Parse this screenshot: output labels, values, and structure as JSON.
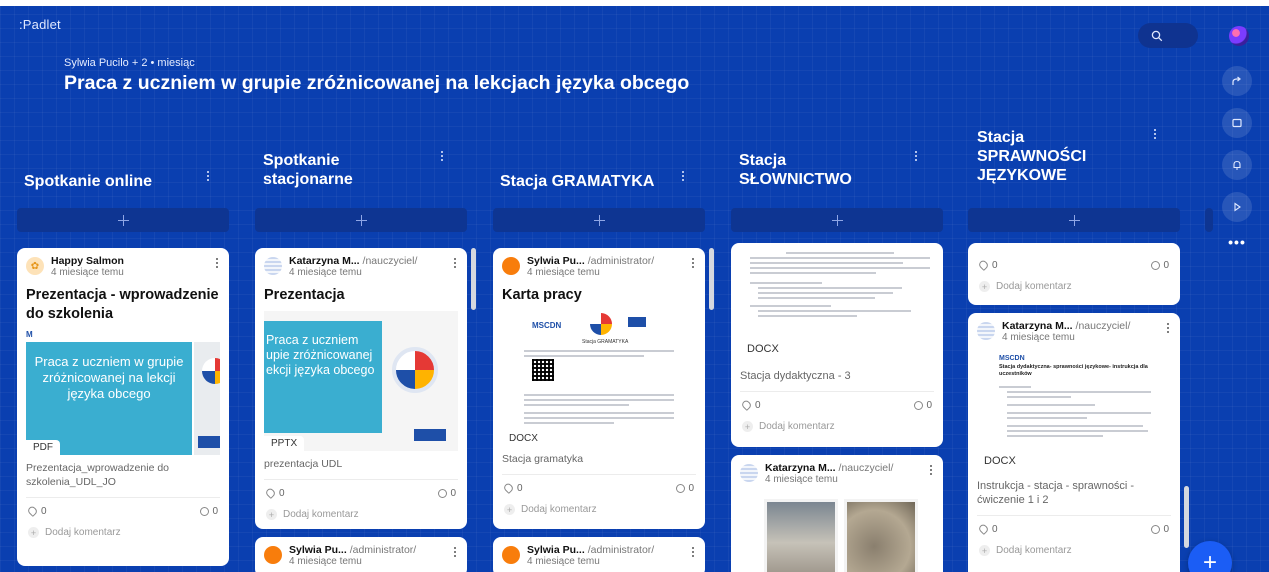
{
  "app": {
    "logo": ":Padlet"
  },
  "header": {
    "meta": "Sylwia Pucilo + 2 • miesiąc",
    "title": "Praca z uczniem w grupie zróżnicowanej na lekcjach języka obcego"
  },
  "icons": {
    "search": "search-icon",
    "share": "share-icon",
    "remake": "copy-icon",
    "notifications": "bell-icon",
    "slideshow": "play-icon",
    "more": "•••"
  },
  "columns": [
    {
      "title": "Spotkanie online"
    },
    {
      "title": "Spotkanie stacjonarne"
    },
    {
      "title": "Stacja GRAMATYKA"
    },
    {
      "title": "Stacja SŁOWNICTWO"
    },
    {
      "title": "Stacja SPRAWNOŚCI JĘZYKOWE"
    }
  ],
  "cards": {
    "c1": {
      "author": "Happy Salmon",
      "time": "4 miesiące temu",
      "title": "Prezentacja - wprowadzenie do szkolenia",
      "preview_text": "Praca z uczniem w grupie zróżnicowanej na lekcji języka obcego",
      "filetype": "PDF",
      "caption": "Prezentacja_wprowadzenie do szkolenia_UDL_JO",
      "likes": "0",
      "comments": "0",
      "add_comment": "Dodaj komentarz"
    },
    "c2": {
      "author": "Katarzyna M...",
      "role": "/nauczyciel/",
      "time": "4 miesiące temu",
      "title": "Prezentacja",
      "preview_text": "Praca z uczniem upie zróżnicowanej ekcji języka obcego",
      "filetype": "PPTX",
      "caption": "prezentacja UDL",
      "likes": "0",
      "comments": "0",
      "add_comment": "Dodaj komentarz"
    },
    "c2b": {
      "author": "Sylwia Pu...",
      "role": "/administrator/",
      "time": "4 miesiące temu"
    },
    "c3": {
      "author": "Sylwia Pu...",
      "role": "/administrator/",
      "time": "4 miesiące temu",
      "title": "Karta pracy",
      "preview_heading": "Stacja GRAMATYKA",
      "preview_brand": "MSCDN",
      "filetype": "DOCX",
      "caption": "Stacja gramatyka",
      "likes": "0",
      "comments": "0",
      "add_comment": "Dodaj komentarz"
    },
    "c3b": {
      "author": "Sylwia Pu...",
      "role": "/administrator/",
      "time": "4 miesiące temu"
    },
    "c4": {
      "filetype": "DOCX",
      "caption": "Stacja dydaktyczna - 3",
      "likes": "0",
      "comments": "0",
      "add_comment": "Dodaj komentarz"
    },
    "c4b": {
      "author": "Katarzyna M...",
      "role": "/nauczyciel/",
      "time": "4 miesiące temu"
    },
    "c5a": {
      "likes": "0",
      "comments": "0",
      "add_comment": "Dodaj komentarz"
    },
    "c5": {
      "author": "Katarzyna M...",
      "role": "/nauczyciel/",
      "time": "4 miesiące temu",
      "preview_brand": "MSCDN",
      "preview_heading": "Stacja dydaktyczna- sprawności językowe- instrukcja dla uczestników",
      "filetype": "DOCX",
      "caption": "Instrukcja - stacja - sprawności - ćwiczenie 1 i 2",
      "likes": "0",
      "comments": "0",
      "add_comment": "Dodaj komentarz"
    }
  },
  "colors": {
    "background": "#0a3fb0",
    "accent": "#1b5df5",
    "card": "#ffffff"
  }
}
